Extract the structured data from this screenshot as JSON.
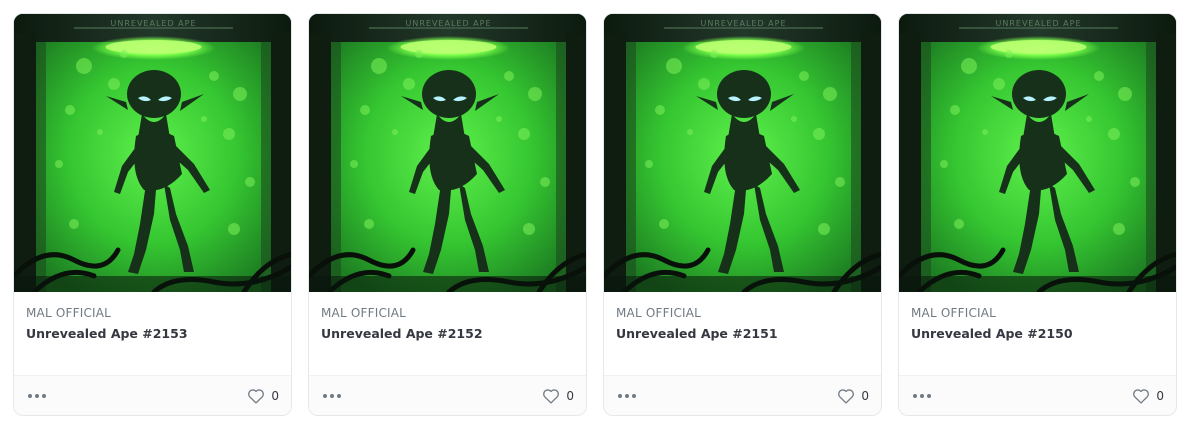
{
  "items": [
    {
      "collection": "MAL OFFICIAL",
      "name": "Unrevealed Ape #2153",
      "favorites": "0"
    },
    {
      "collection": "MAL OFFICIAL",
      "name": "Unrevealed Ape #2152",
      "favorites": "0"
    },
    {
      "collection": "MAL OFFICIAL",
      "name": "Unrevealed Ape #2151",
      "favorites": "0"
    },
    {
      "collection": "MAL OFFICIAL",
      "name": "Unrevealed Ape #2150",
      "favorites": "0"
    }
  ],
  "artwork": {
    "label": "UNREVEALED APE",
    "icon": "alien-in-tank-artwork",
    "colors": {
      "liquid": "#3fd23a",
      "glow": "#7dff4a",
      "eyes": "#9fe8ff",
      "frame": "#1a2a1c"
    }
  },
  "icons": {
    "more": "more-horizontal-icon",
    "favorite": "heart-outline-icon"
  }
}
